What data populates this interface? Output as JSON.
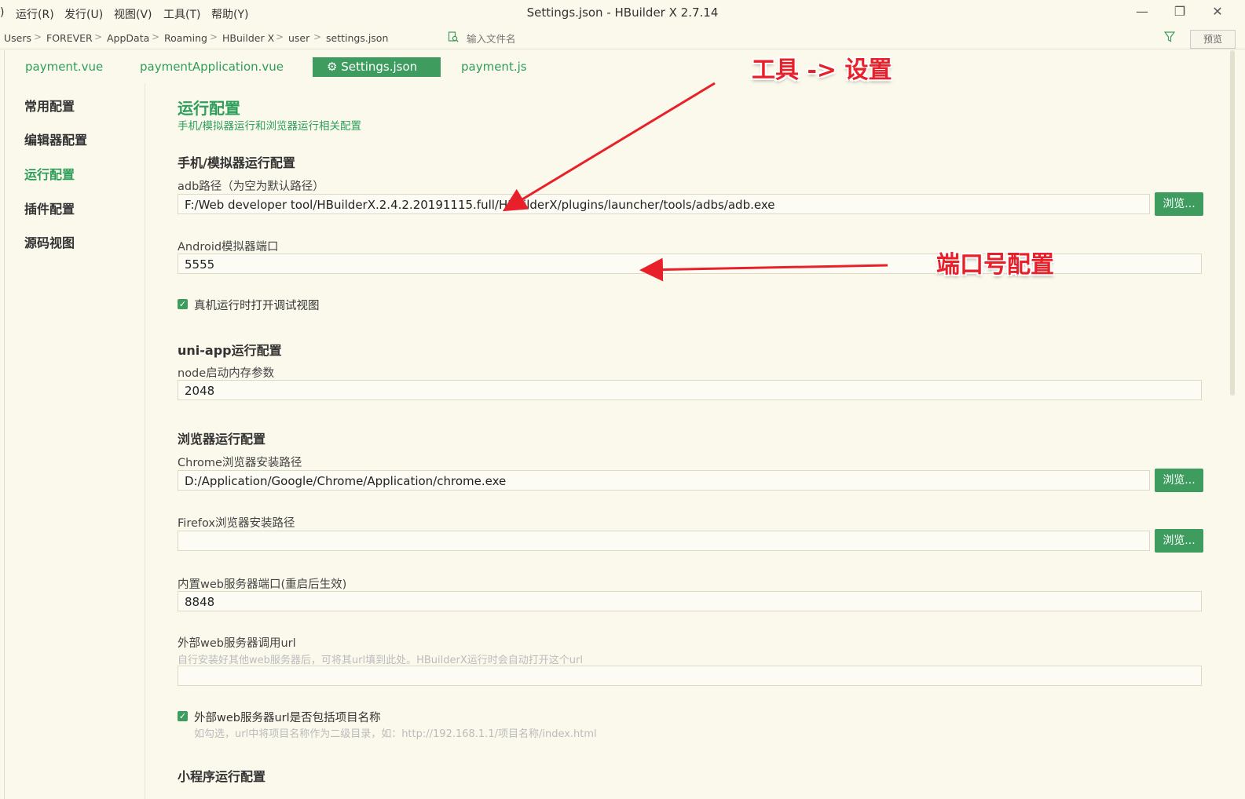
{
  "menu": {
    "items": [
      ")",
      "运行(R)",
      "发行(U)",
      "视图(V)",
      "工具(T)",
      "帮助(Y)"
    ]
  },
  "window": {
    "title": "Settings.json - HBuilder X 2.7.14",
    "minimize": "—",
    "restore": "❐",
    "close": "✕"
  },
  "breadcrumb": {
    "items": [
      "Users",
      "FOREVER",
      "AppData",
      "Roaming",
      "HBuilder X",
      "user",
      "settings.json"
    ],
    "separator": ">"
  },
  "file_search": {
    "placeholder": "输入文件名"
  },
  "preview_label": "预览",
  "tabs": [
    {
      "label": "payment.vue"
    },
    {
      "label": "paymentApplication.vue"
    },
    {
      "label": "⚙ Settings.json"
    },
    {
      "label": "payment.js"
    }
  ],
  "nav": {
    "items": [
      "常用配置",
      "编辑器配置",
      "运行配置",
      "插件配置",
      "源码视图"
    ],
    "active_index": 2
  },
  "section": {
    "title": "运行配置",
    "subtitle": "手机/模拟器运行和浏览器运行相关配置"
  },
  "mobile": {
    "title": "手机/模拟器运行配置",
    "adb_label": "adb路径（为空为默认路径）",
    "adb_value": "F:/Web developer tool/HBuilderX.2.4.2.20191115.full/HBuilderX/plugins/launcher/tools/adbs/adb.exe",
    "browse": "浏览...",
    "port_label": "Android模拟器端口",
    "port_value": "5555",
    "debug_check_label": "真机运行时打开调试视图",
    "debug_checked": true
  },
  "uniapp": {
    "title": "uni-app运行配置",
    "node_label": "node启动内存参数",
    "node_value": "2048"
  },
  "browser": {
    "title": "浏览器运行配置",
    "chrome_label": "Chrome浏览器安装路径",
    "chrome_value": "D:/Application/Google/Chrome/Application/chrome.exe",
    "firefox_label": "Firefox浏览器安装路径",
    "firefox_value": "",
    "web_port_label": "内置web服务器端口(重启后生效)",
    "web_port_value": "8848",
    "ext_url_label": "外部web服务器调用url",
    "ext_url_hint": "自行安装好其他web服务器后，可将其url填到此处。HBuilderX运行时会自动打开这个url",
    "ext_url_value": "",
    "include_name_label": "外部web服务器url是否包括项目名称",
    "include_name_hint": "如勾选，url中将项目名称作为二级目录，如：http://192.168.1.1/项目名称/index.html",
    "include_name_checked": true
  },
  "miniprogram": {
    "title": "小程序运行配置"
  },
  "annotations": {
    "tools_settings": "工具 -> 设置",
    "port_config": "端口号配置",
    "color": "#e8202a"
  },
  "colors": {
    "accent": "#3d9c5e",
    "background": "#fbf9ec"
  }
}
